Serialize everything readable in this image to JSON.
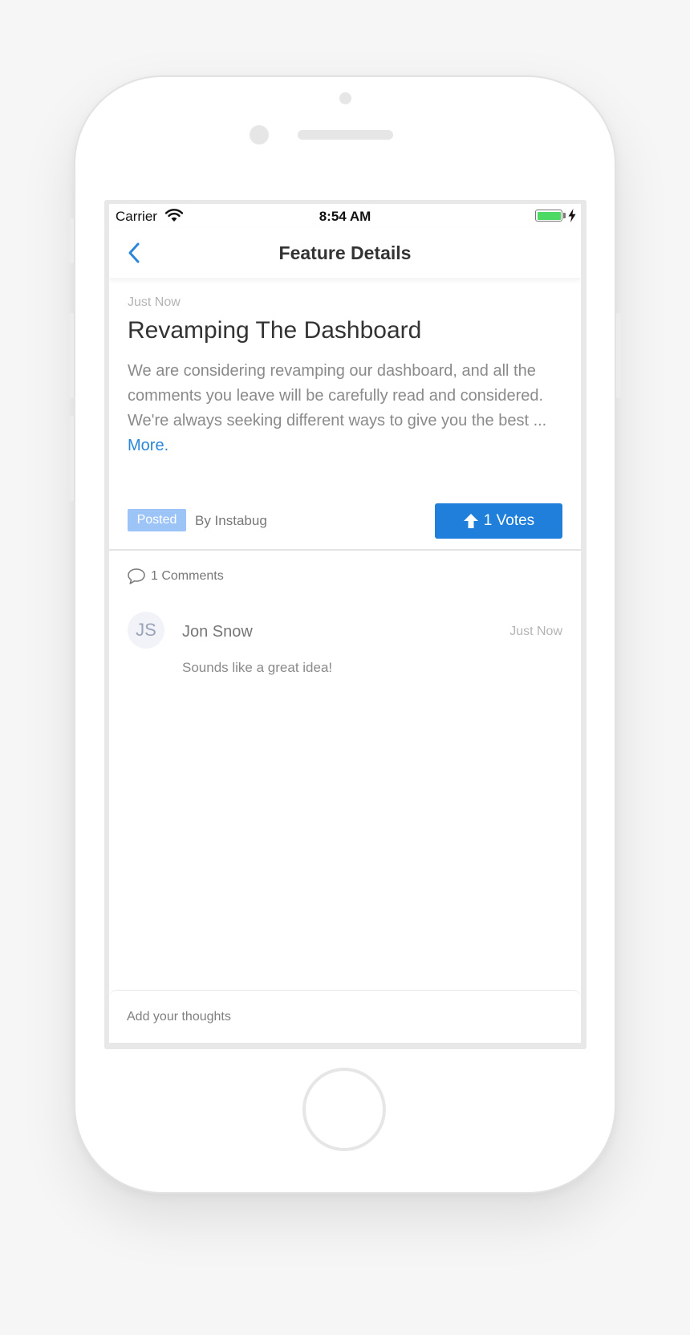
{
  "status_bar": {
    "carrier": "Carrier",
    "time": "8:54 AM",
    "wifi_icon": "wifi-icon",
    "battery_icon": "battery-icon",
    "charging_icon": "bolt-icon",
    "battery_level": 1.0
  },
  "nav": {
    "title": "Feature Details",
    "back_icon": "chevron-left-icon"
  },
  "feature": {
    "time_ago": "Just Now",
    "title": "Revamping The Dashboard",
    "description": "We are considering revamping our dashboard, and all the comments you leave will be carefully read and considered. We're always seeking different ways to give you the best ...",
    "more_label": "More.",
    "status_badge": "Posted",
    "byline": "By Instabug",
    "vote_label": "1 Votes",
    "vote_icon": "arrow-up-icon"
  },
  "comments": {
    "count_label": "1 Comments",
    "icon": "speech-bubble-icon",
    "items": [
      {
        "initials": "JS",
        "author": "Jon Snow",
        "time": "Just Now",
        "body": "Sounds like a great idea!"
      }
    ]
  },
  "composer": {
    "placeholder": "Add your thoughts",
    "value": ""
  },
  "colors": {
    "accent": "#1f7fdb",
    "link": "#2a86d9",
    "badge": "#9cc4f6",
    "battery": "#4cd964"
  }
}
